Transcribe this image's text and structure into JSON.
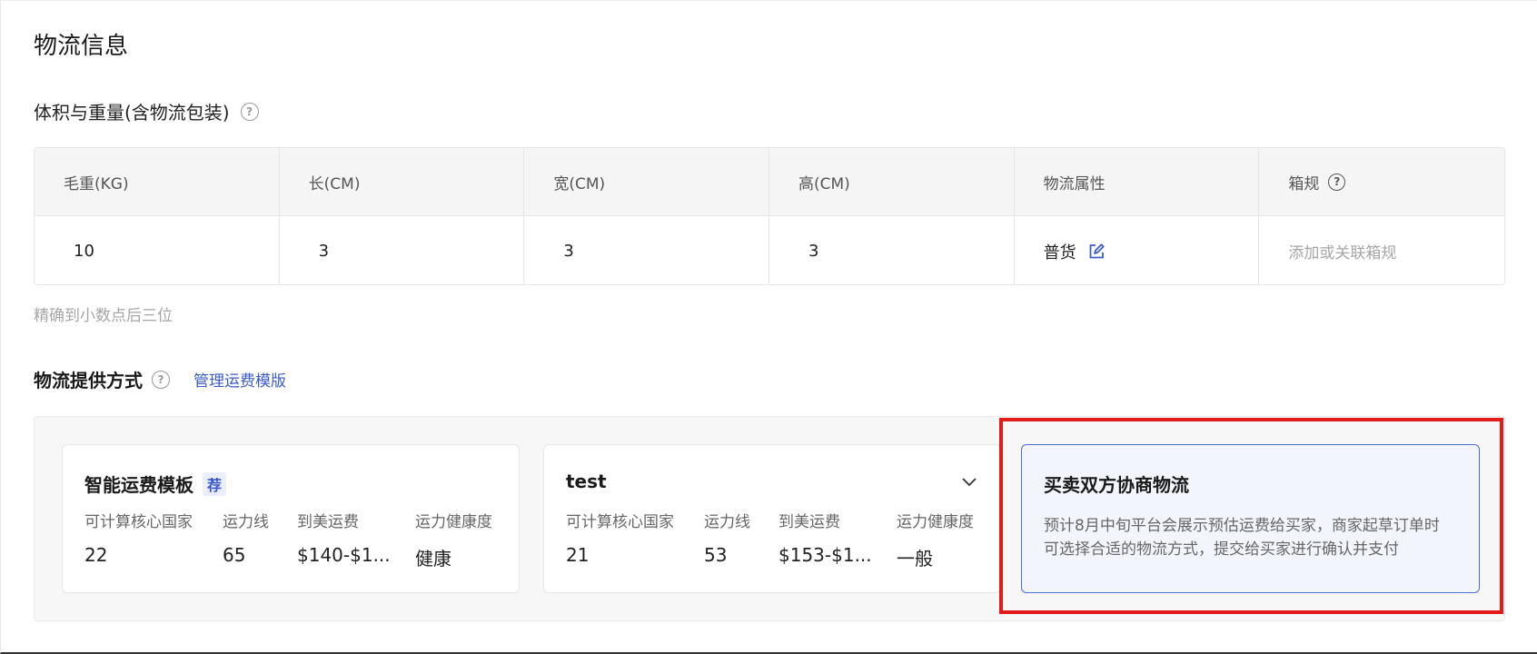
{
  "section_title": "物流信息",
  "volume_weight": {
    "title": "体积与重量(含物流包装)",
    "headers": [
      "毛重(KG)",
      "长(CM)",
      "宽(CM)",
      "高(CM)",
      "物流属性",
      "箱规"
    ],
    "values": {
      "weight": "10",
      "length": "3",
      "width": "3",
      "height": "3",
      "attribute": "普货",
      "box_spec_placeholder": "添加或关联箱规"
    },
    "hint": "精确到小数点后三位"
  },
  "provider": {
    "title": "物流提供方式",
    "manage_link": "管理运费模版",
    "cards": [
      {
        "title": "智能运费模板",
        "badge": "荐",
        "labels": [
          "可计算核心国家",
          "运力线",
          "到美运费",
          "运力健康度"
        ],
        "values": [
          "22",
          "65",
          "$140-$1...",
          "健康"
        ]
      },
      {
        "title": "test",
        "labels": [
          "可计算核心国家",
          "运力线",
          "到美运费",
          "运力健康度"
        ],
        "values": [
          "21",
          "53",
          "$153-$1...",
          "一般"
        ]
      }
    ],
    "negotiated": {
      "title": "买卖双方协商物流",
      "description": "预计8月中旬平台会展示预估运费给买家，商家起草订单时可选择合适的物流方式，提交给买家进行确认并支付"
    }
  },
  "colors": {
    "accent": "#3a5ccc",
    "highlight": "#e31b1b"
  }
}
